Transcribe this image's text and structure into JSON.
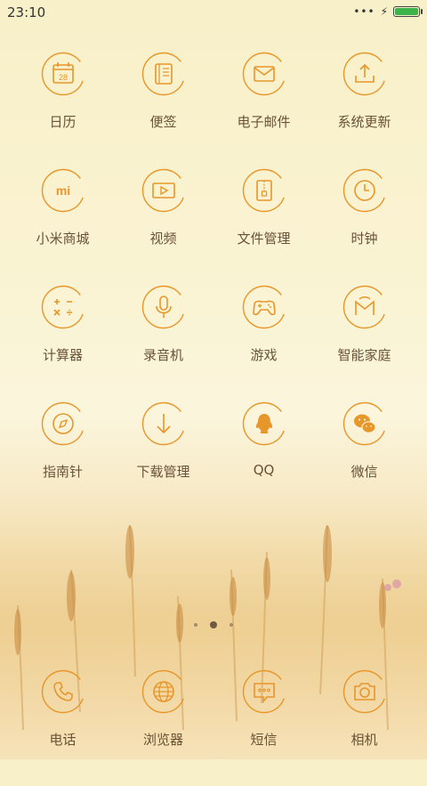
{
  "status": {
    "time": "23:10",
    "dots": "•••",
    "charging": "⚡",
    "battery_level": 1.0
  },
  "colors": {
    "accent": "#e7962a",
    "label": "#6a5236",
    "battery": "#3cb44a"
  },
  "apps": [
    {
      "label": "日历",
      "icon": "calendar-icon",
      "day": "28"
    },
    {
      "label": "便签",
      "icon": "notes-icon"
    },
    {
      "label": "电子邮件",
      "icon": "mail-icon"
    },
    {
      "label": "系统更新",
      "icon": "update-icon"
    },
    {
      "label": "小米商城",
      "icon": "mi-store-icon",
      "logo": "mi"
    },
    {
      "label": "视频",
      "icon": "video-icon"
    },
    {
      "label": "文件管理",
      "icon": "file-manager-icon"
    },
    {
      "label": "时钟",
      "icon": "clock-icon"
    },
    {
      "label": "计算器",
      "icon": "calculator-icon"
    },
    {
      "label": "录音机",
      "icon": "recorder-icon"
    },
    {
      "label": "游戏",
      "icon": "gamepad-icon"
    },
    {
      "label": "智能家庭",
      "icon": "smart-home-icon"
    },
    {
      "label": "指南针",
      "icon": "compass-icon"
    },
    {
      "label": "下载管理",
      "icon": "download-icon"
    },
    {
      "label": "QQ",
      "icon": "qq-icon"
    },
    {
      "label": "微信",
      "icon": "wechat-icon"
    }
  ],
  "pager": {
    "pages": 3,
    "current": 2
  },
  "dock": [
    {
      "label": "电话",
      "icon": "phone-icon"
    },
    {
      "label": "浏览器",
      "icon": "browser-icon"
    },
    {
      "label": "短信",
      "icon": "sms-icon"
    },
    {
      "label": "相机",
      "icon": "camera-icon"
    }
  ]
}
